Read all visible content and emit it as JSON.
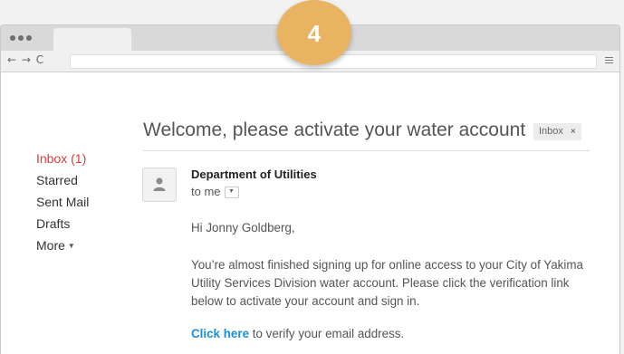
{
  "step_badge": "4",
  "browser": {
    "nav_buttons": "← → C"
  },
  "sidebar": {
    "items": [
      {
        "label": "Inbox (1)"
      },
      {
        "label": "Starred"
      },
      {
        "label": "Sent Mail"
      },
      {
        "label": "Drafts"
      },
      {
        "label": "More"
      }
    ]
  },
  "email": {
    "subject": "Welcome, please activate your water account",
    "label": "Inbox",
    "label_close": "×",
    "sender": "Department of Utilities",
    "recipient": "to me",
    "greeting": "Hi Jonny Goldberg,",
    "paragraph": "You’re almost finished signing up for online access to your City of Yakima Utility Services Division water account. Please click the verification link below to activate your account and sign in.",
    "link_text": "Click here",
    "link_suffix": " to verify your email address."
  },
  "colors": {
    "accent": "#d93a3a",
    "badge": "#e8b462",
    "link": "#1a8fd6"
  },
  "icons": [
    "menu-icon",
    "person-icon",
    "chevron-down-icon",
    "close-icon"
  ]
}
